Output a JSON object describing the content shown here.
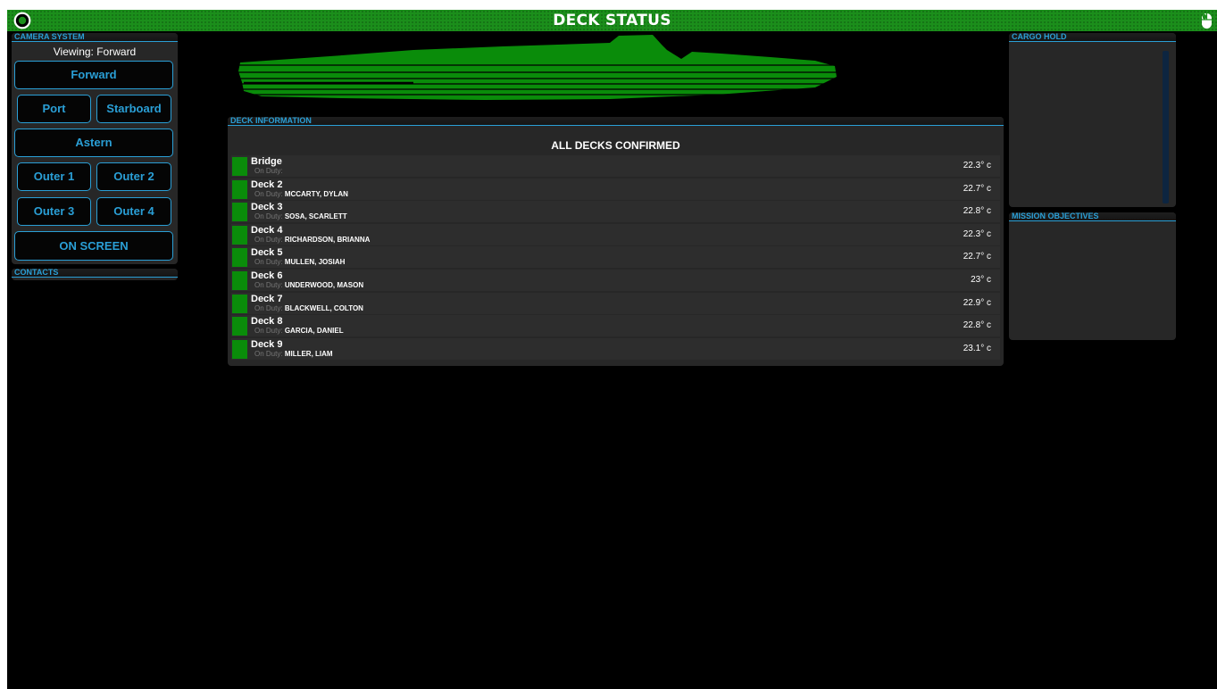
{
  "header": {
    "title": "DECK STATUS",
    "left_icon": "power-icon",
    "right_icon": "mouse-icon",
    "color": "#1b8e1b"
  },
  "camera_system": {
    "title": "CAMERA SYSTEM",
    "viewing": "Viewing: Forward",
    "buttons": {
      "forward": "Forward",
      "port": "Port",
      "starboard": "Starboard",
      "astern": "Astern",
      "outer1": "Outer 1",
      "outer2": "Outer 2",
      "outer3": "Outer 3",
      "outer4": "Outer 4",
      "on_screen": "ON SCREEN"
    }
  },
  "contacts": {
    "title": "CONTACTS"
  },
  "deck_information": {
    "title": "DECK INFORMATION",
    "status": "ALL DECKS CONFIRMED",
    "on_duty_label": "On Duty:",
    "decks": [
      {
        "name": "Bridge",
        "crew": "",
        "temp": "22.3° c"
      },
      {
        "name": "Deck 2",
        "crew": "MCCARTY, DYLAN",
        "temp": "22.7° c"
      },
      {
        "name": "Deck 3",
        "crew": "SOSA, SCARLETT",
        "temp": "22.8° c"
      },
      {
        "name": "Deck 4",
        "crew": "RICHARDSON, BRIANNA",
        "temp": "22.3° c"
      },
      {
        "name": "Deck 5",
        "crew": "MULLEN, JOSIAH",
        "temp": "22.7° c"
      },
      {
        "name": "Deck 6",
        "crew": "UNDERWOOD, MASON",
        "temp": "23° c"
      },
      {
        "name": "Deck 7",
        "crew": "BLACKWELL, COLTON",
        "temp": "22.9° c"
      },
      {
        "name": "Deck 8",
        "crew": "GARCIA, DANIEL",
        "temp": "22.8° c"
      },
      {
        "name": "Deck 9",
        "crew": "MILLER, LIAM",
        "temp": "23.1° c"
      }
    ]
  },
  "cargo_hold": {
    "title": "CARGO HOLD"
  },
  "mission_objectives": {
    "title": "MISSION OBJECTIVES"
  },
  "colors": {
    "accent": "#2a9fd6",
    "deck_ok": "#0a8c0a",
    "ship": "#0a8c0a",
    "background": "#000000",
    "panel": "#272727"
  }
}
